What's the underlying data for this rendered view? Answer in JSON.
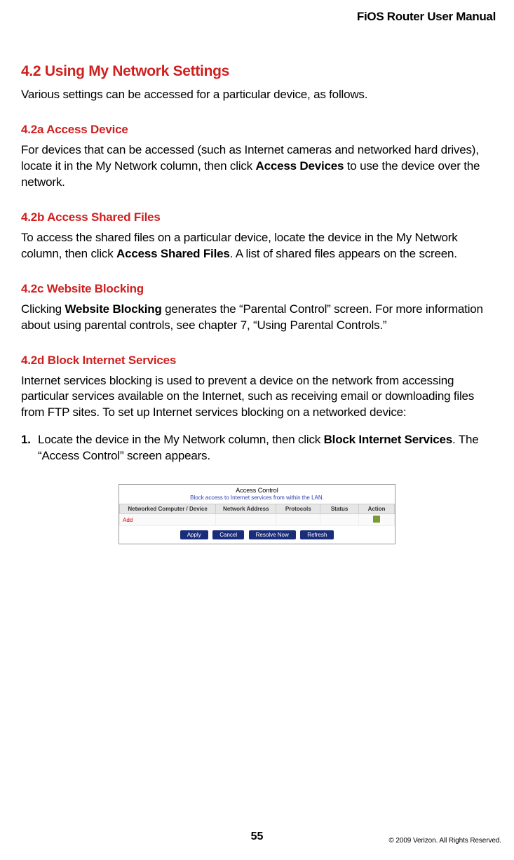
{
  "header": {
    "title": "FiOS Router User Manual"
  },
  "section": {
    "heading": "4.2  Using My Network Settings",
    "intro": "Various settings can be accessed for a particular device, as follows."
  },
  "s42a": {
    "heading": "4.2a  Access Device",
    "p1_pre": "For devices that can be accessed (such as Internet cameras and networked hard drives), locate it in the My Network column, then click ",
    "p1_bold": "Access Devices",
    "p1_post": " to use the device over the network."
  },
  "s42b": {
    "heading": "4.2b  Access Shared Files",
    "p1_pre": "To access the shared files on a particular device, locate the device in the My Network column, then click ",
    "p1_bold": "Access Shared Files",
    "p1_post": ". A list of shared files appears on the screen."
  },
  "s42c": {
    "heading": "4.2c  Website Blocking",
    "p1_pre": "Clicking ",
    "p1_bold": "Website Blocking",
    "p1_post": " generates the “Parental Control” screen. For more information about using parental controls, see chapter 7, “Using Parental Controls.”"
  },
  "s42d": {
    "heading": "4.2d  Block Internet Services",
    "p1": "Internet services blocking is used to prevent a device on the network from accessing particular services available on the Internet, such as receiving email or downloading files from FTP sites. To set up Internet services blocking on a networked device:",
    "step1_num": "1.",
    "step1_pre": "Locate the device in the My Network column, then click ",
    "step1_bold": "Block Internet Services",
    "step1_post": ". The “Access Control” screen appears."
  },
  "shot": {
    "title": "Access Control",
    "subtitle": "Block access to Internet services from within the LAN.",
    "cols": {
      "c0": "Networked Computer / Device",
      "c1": "Network Address",
      "c2": "Protocols",
      "c3": "Status",
      "c4": "Action"
    },
    "add": "Add",
    "btns": {
      "b0": "Apply",
      "b1": "Cancel",
      "b2": "Resolve Now",
      "b3": "Refresh"
    }
  },
  "footer": {
    "page": "55",
    "copyright": "© 2009 Verizon. All Rights Reserved."
  }
}
